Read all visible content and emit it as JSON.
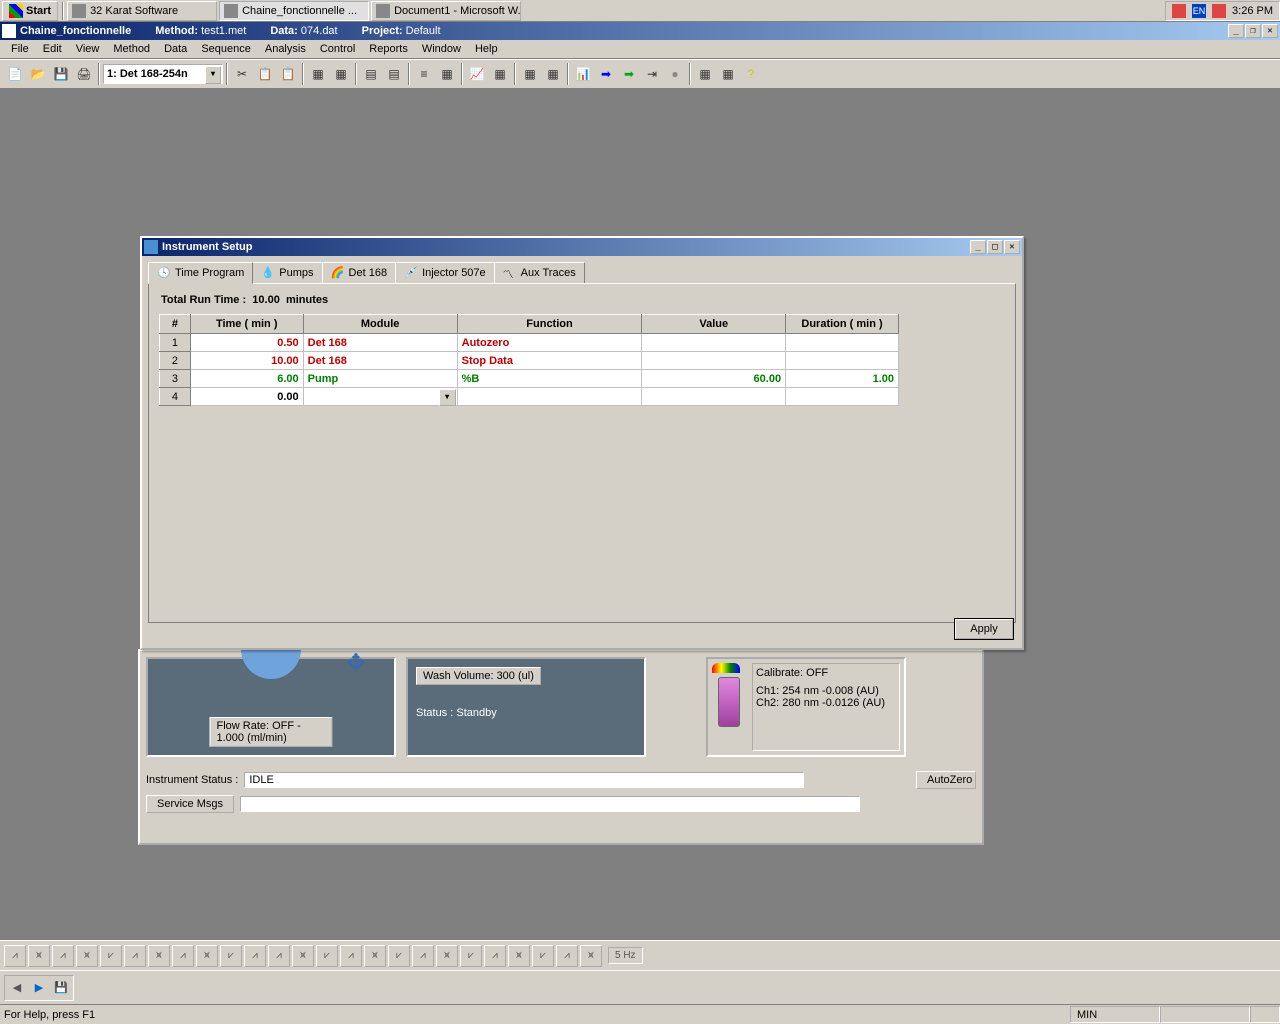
{
  "taskbar": {
    "start": "Start",
    "items": [
      {
        "label": "32 Karat Software",
        "active": false
      },
      {
        "label": "Chaine_fonctionnelle  ...",
        "active": true
      },
      {
        "label": "Document1 - Microsoft W...",
        "active": false
      }
    ],
    "lang": "EN",
    "clock": "3:26 PM"
  },
  "app_title": {
    "name": "Chaine_fonctionnelle",
    "method_label": "Method:",
    "method": "test1.met",
    "data_label": "Data:",
    "data": "074.dat",
    "project_label": "Project:",
    "project": "Default"
  },
  "menu": [
    "File",
    "Edit",
    "View",
    "Method",
    "Data",
    "Sequence",
    "Analysis",
    "Control",
    "Reports",
    "Window",
    "Help"
  ],
  "toolbar_combo": "1: Det 168-254n",
  "dialog": {
    "title": "Instrument Setup",
    "tabs": [
      "Time Program",
      "Pumps",
      "Det 168",
      "Injector 507e",
      "Aux Traces"
    ],
    "runtime_label": "Total Run Time :",
    "runtime_value": "10.00",
    "runtime_unit": "minutes",
    "headers": {
      "n": "#",
      "time": "Time ( min )",
      "module": "Module",
      "fn": "Function",
      "val": "Value",
      "dur": "Duration ( min )"
    },
    "rows": [
      {
        "n": "1",
        "time": "0.50",
        "module": "Det 168",
        "fn": "Autozero",
        "val": "",
        "dur": "",
        "cls": "c-red"
      },
      {
        "n": "2",
        "time": "10.00",
        "module": "Det 168",
        "fn": "Stop Data",
        "val": "",
        "dur": "",
        "cls": "c-red"
      },
      {
        "n": "3",
        "time": "6.00",
        "module": "Pump",
        "fn": "%B",
        "val": "60.00",
        "dur": "1.00",
        "cls": "c-green"
      },
      {
        "n": "4",
        "time": "0.00",
        "module": "",
        "fn": "",
        "val": "",
        "dur": "",
        "cls": ""
      }
    ],
    "apply": "Apply"
  },
  "panel": {
    "flow_rate": "Flow Rate: OFF - 1.000 (ml/min)",
    "wash_volume": "Wash Volume: 300 (ul)",
    "status": "Status : Standby",
    "calibrate": "Calibrate: OFF",
    "ch1": "Ch1: 254 nm  -0.008 (AU)",
    "ch2": "Ch2: 280 nm  -0.0126 (AU)",
    "instr_label": "Instrument Status :",
    "instr_value": "IDLE",
    "autozero": "AutoZero",
    "svc_msgs": "Service Msgs"
  },
  "bottom": {
    "rate": "5 Hz"
  },
  "statusbar": {
    "help": "For Help, press F1",
    "min": "MIN"
  }
}
